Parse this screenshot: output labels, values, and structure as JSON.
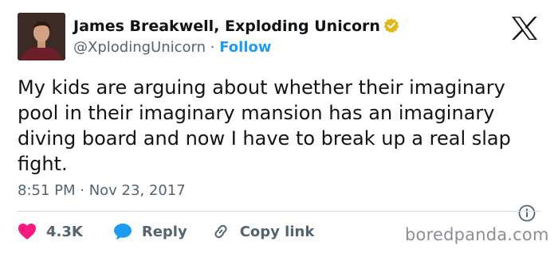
{
  "author": {
    "display_name": "James Breakwell, Exploding Unicorn",
    "handle": "@XplodingUnicorn",
    "separator": "·",
    "follow_label": "Follow"
  },
  "tweet": {
    "text": "My kids are arguing about whether their imaginary pool in their imaginary mansion has an imaginary diving board and now I have to break up a real slap fight.",
    "timestamp": "8:51 PM · Nov 23, 2017"
  },
  "actions": {
    "like_count": "4.3K",
    "reply_label": "Reply",
    "copy_label": "Copy link"
  },
  "watermark": "boredpanda.com",
  "colors": {
    "accent": "#1d9bf0",
    "like": "#f91880",
    "verified": "#e2b719",
    "secondary_text": "#536471"
  },
  "icons": [
    "verified-badge-icon",
    "x-logo-icon",
    "info-icon",
    "heart-icon",
    "reply-bubble-icon",
    "link-icon"
  ]
}
